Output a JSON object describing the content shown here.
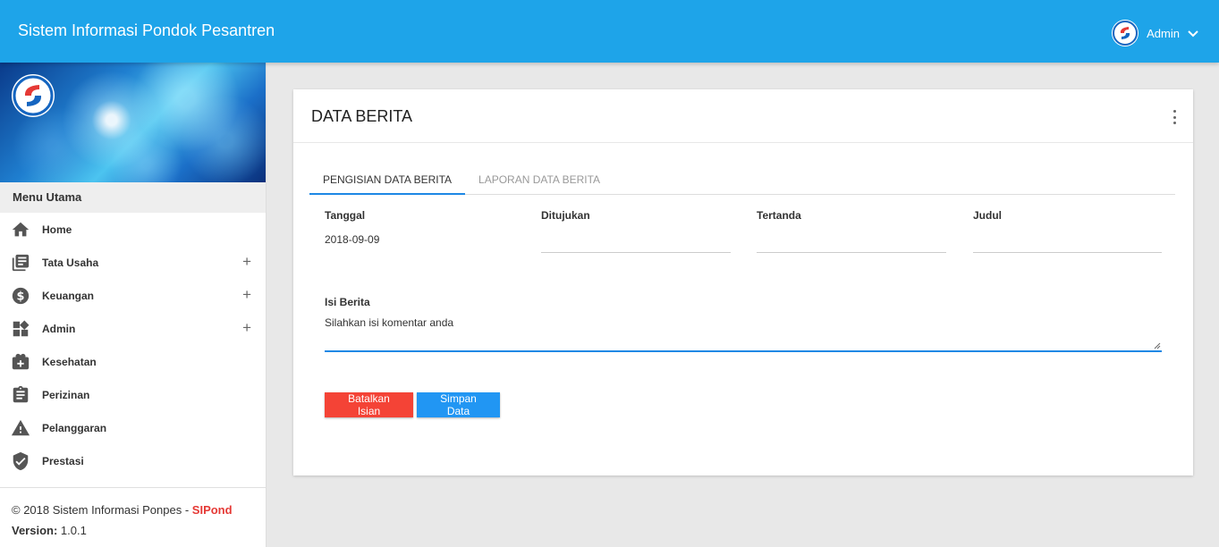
{
  "header": {
    "title": "Sistem Informasi Pondok Pesantren",
    "user": {
      "name": "Admin",
      "avatar_icon": "sipond-logo-icon",
      "menu_icon": "chevron-down-icon"
    },
    "color": "#1ea4e9"
  },
  "sidebar": {
    "menu_heading": "Menu Utama",
    "items": [
      {
        "label": "Home",
        "icon": "home-icon",
        "expandable": false
      },
      {
        "label": "Tata Usaha",
        "icon": "library-books-icon",
        "expandable": true
      },
      {
        "label": "Keuangan",
        "icon": "dollar-circle-icon",
        "expandable": true
      },
      {
        "label": "Admin",
        "icon": "widgets-icon",
        "expandable": true
      },
      {
        "label": "Kesehatan",
        "icon": "medical-kit-icon",
        "expandable": false
      },
      {
        "label": "Perizinan",
        "icon": "clipboard-icon",
        "expandable": false
      },
      {
        "label": "Pelanggaran",
        "icon": "warning-icon",
        "expandable": false
      },
      {
        "label": "Prestasi",
        "icon": "verified-shield-icon",
        "expandable": false
      }
    ],
    "expand_symbol": "+",
    "footer": {
      "copyright": "© 2018 Sistem Informasi Ponpes - ",
      "brand": "SIPond",
      "version_label": "Version:",
      "version_value": "1.0.1"
    }
  },
  "card": {
    "title": "DATA BERITA",
    "menu_icon": "more-vert-icon",
    "tabs": [
      {
        "label": "PENGISIAN DATA BERITA",
        "active": true
      },
      {
        "label": "LAPORAN DATA BERITA",
        "active": false
      }
    ],
    "fields": {
      "tanggal": {
        "label": "Tanggal",
        "value": "2018-09-09"
      },
      "ditujukan": {
        "label": "Ditujukan",
        "value": ""
      },
      "tertanda": {
        "label": "Tertanda",
        "value": ""
      },
      "judul": {
        "label": "Judul",
        "value": ""
      }
    },
    "isi_berita": {
      "label": "Isi Berita",
      "placeholder": "Silahkan isi komentar anda"
    },
    "buttons": {
      "cancel": {
        "label": "Batalkan Isian",
        "color": "#f44336"
      },
      "save": {
        "label": "Simpan Data",
        "color": "#2196f3"
      }
    }
  }
}
